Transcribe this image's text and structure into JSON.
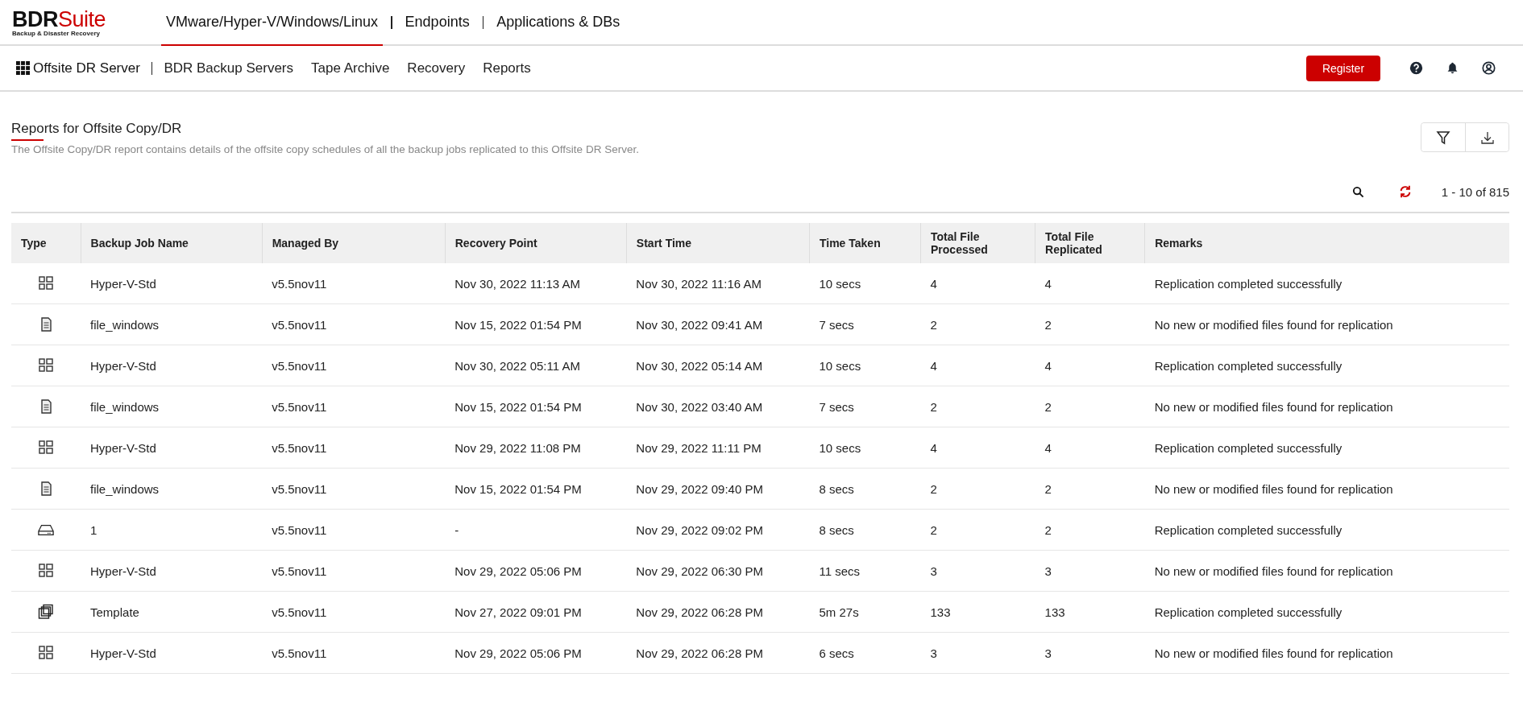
{
  "logo": {
    "brand_a": "BDR",
    "brand_b": "Suite",
    "tagline": "Backup & Disaster Recovery"
  },
  "top_tabs": [
    {
      "label": "VMware/Hyper-V/Windows/Linux",
      "selected": true
    },
    {
      "label": "Endpoints",
      "selected": false
    },
    {
      "label": "Applications & DBs",
      "selected": false
    }
  ],
  "nav": {
    "product": "Offsite DR Server",
    "items": [
      {
        "label": "BDR Backup Servers",
        "selected": false
      },
      {
        "label": "Tape Archive",
        "selected": false
      },
      {
        "label": "Recovery",
        "selected": false
      },
      {
        "label": "Reports",
        "selected": false
      }
    ],
    "register": "Register"
  },
  "page": {
    "title": "Reports for Offsite Copy/DR",
    "description": "The Offsite Copy/DR report contains details of the offsite copy schedules of all the backup jobs replicated to this Offsite DR Server."
  },
  "pagination": "1 - 10 of 815",
  "table": {
    "columns": [
      "Type",
      "Backup Job Name",
      "Managed By",
      "Recovery Point",
      "Start Time",
      "Time Taken",
      "Total File Processed",
      "Total File Replicated",
      "Remarks"
    ],
    "rows": [
      {
        "kind": "vm",
        "cells": [
          "",
          "Hyper-V-Std",
          "v5.5nov11",
          "Nov 30, 2022 11:13 AM",
          "Nov 30, 2022 11:16 AM",
          "10 secs",
          "4",
          "4",
          "Replication completed successfully"
        ]
      },
      {
        "kind": "file",
        "cells": [
          "",
          "file_windows",
          "v5.5nov11",
          "Nov 15, 2022 01:54 PM",
          "Nov 30, 2022 09:41 AM",
          "7 secs",
          "2",
          "2",
          "No new or modified files found for replication"
        ]
      },
      {
        "kind": "vm",
        "cells": [
          "",
          "Hyper-V-Std",
          "v5.5nov11",
          "Nov 30, 2022 05:11 AM",
          "Nov 30, 2022 05:14 AM",
          "10 secs",
          "4",
          "4",
          "Replication completed successfully"
        ]
      },
      {
        "kind": "file",
        "cells": [
          "",
          "file_windows",
          "v5.5nov11",
          "Nov 15, 2022 01:54 PM",
          "Nov 30, 2022 03:40 AM",
          "7 secs",
          "2",
          "2",
          "No new or modified files found for replication"
        ]
      },
      {
        "kind": "vm",
        "cells": [
          "",
          "Hyper-V-Std",
          "v5.5nov11",
          "Nov 29, 2022 11:08 PM",
          "Nov 29, 2022 11:11 PM",
          "10 secs",
          "4",
          "4",
          "Replication completed successfully"
        ]
      },
      {
        "kind": "file",
        "cells": [
          "",
          "file_windows",
          "v5.5nov11",
          "Nov 15, 2022 01:54 PM",
          "Nov 29, 2022 09:40 PM",
          "8 secs",
          "2",
          "2",
          "No new or modified files found for replication"
        ]
      },
      {
        "kind": "disk",
        "cells": [
          "",
          "1",
          "v5.5nov11",
          "-",
          "Nov 29, 2022 09:02 PM",
          "8 secs",
          "2",
          "2",
          "Replication completed successfully"
        ]
      },
      {
        "kind": "vm",
        "cells": [
          "",
          "Hyper-V-Std",
          "v5.5nov11",
          "Nov 29, 2022 05:06 PM",
          "Nov 29, 2022 06:30 PM",
          "11 secs",
          "3",
          "3",
          "No new or modified files found for replication"
        ]
      },
      {
        "kind": "template",
        "cells": [
          "",
          "Template",
          "v5.5nov11",
          "Nov 27, 2022 09:01 PM",
          "Nov 29, 2022 06:28 PM",
          "5m 27s",
          "133",
          "133",
          "Replication completed successfully"
        ]
      },
      {
        "kind": "vm",
        "cells": [
          "",
          "Hyper-V-Std",
          "v5.5nov11",
          "Nov 29, 2022 05:06 PM",
          "Nov 29, 2022 06:28 PM",
          "6 secs",
          "3",
          "3",
          "No new or modified files found for replication"
        ]
      }
    ]
  }
}
